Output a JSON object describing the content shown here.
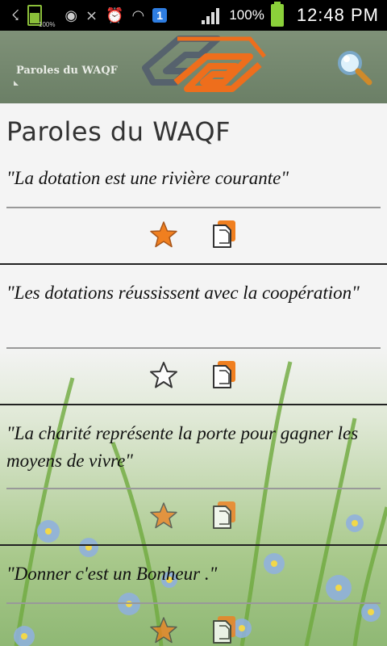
{
  "status_bar": {
    "battery_small_label": "100%",
    "notification_count": "1",
    "battery_percent": "100%",
    "time": "12:48 PM"
  },
  "app_bar": {
    "title": "Paroles du WAQF",
    "icons": {
      "logo": "waqf-logo",
      "search": "search-icon"
    },
    "logo_colors": {
      "grey": "#56626d",
      "orange": "#ee6e1c"
    }
  },
  "page": {
    "title": "Paroles du WAQF"
  },
  "quotes": [
    {
      "text": "\"La dotation est une rivière courante\"",
      "favorite": true
    },
    {
      "text": "\"Les dotations réussissent avec la coopération\"",
      "favorite": false
    },
    {
      "text": "\"La charité représente la porte pour gagner les moyens de vivre\"",
      "favorite": true
    },
    {
      "text": "\"Donner c'est un Bonheur .\"",
      "favorite": true
    }
  ],
  "colors": {
    "accent": "#f07f1f",
    "header": "#75886f"
  }
}
